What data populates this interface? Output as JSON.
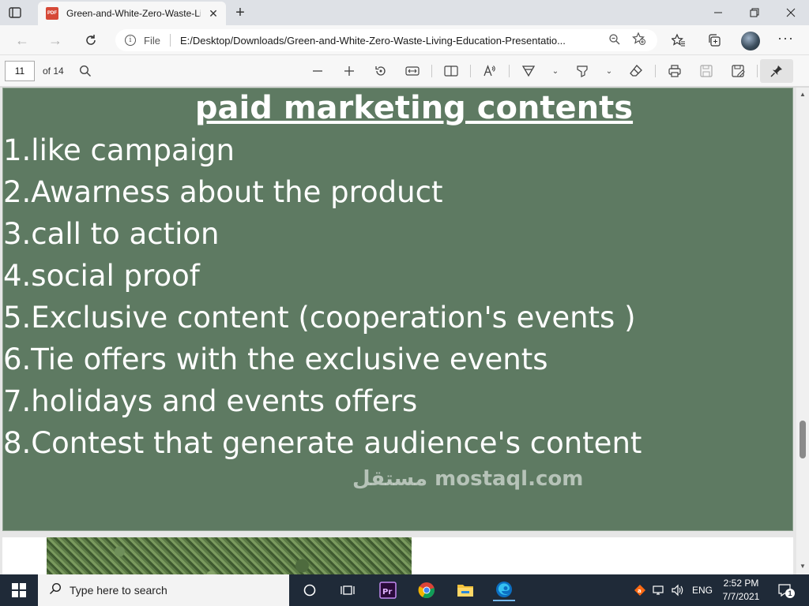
{
  "browser": {
    "tab_title": "Green-and-White-Zero-Waste-Li",
    "address_scheme": "File",
    "url": "E:/Desktop/Downloads/Green-and-White-Zero-Waste-Living-Education-Presentatio..."
  },
  "pdf_toolbar": {
    "current_page": "11",
    "page_count": "of 14"
  },
  "slide": {
    "title": "paid marketing contents",
    "items": [
      "1.like campaign",
      "2.Awarness about the product",
      "3.call to action",
      "4.social proof",
      "5.Exclusive content (cooperation's events )",
      "6.Tie offers with the exclusive events",
      "7.holidays and events offers",
      "8.Contest that generate audience's content"
    ],
    "background_color": "#5e7a62"
  },
  "watermark": {
    "text": "مستقل mostaql.com"
  },
  "taskbar": {
    "search_placeholder": "Type here to search",
    "language": "ENG",
    "time": "2:52 PM",
    "date": "7/7/2021",
    "notification_count": "1"
  }
}
